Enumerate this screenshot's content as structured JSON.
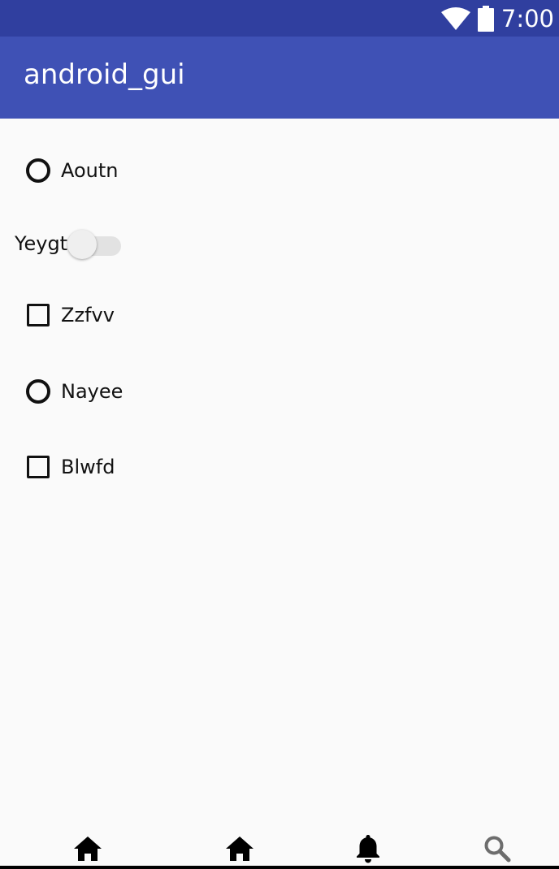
{
  "status_bar": {
    "time": "7:00",
    "icons": [
      "wifi-icon",
      "battery-icon"
    ],
    "color": "#303f9f"
  },
  "app_bar": {
    "title": "android_gui",
    "color": "#3f51b5"
  },
  "controls": {
    "radio_1": {
      "label": "Aoutn",
      "checked": false
    },
    "switch_1": {
      "label": "Yeygt",
      "on": false
    },
    "checkbox_1": {
      "label": "Zzfvv",
      "checked": false
    },
    "radio_2": {
      "label": "Nayee",
      "checked": false
    },
    "checkbox_2": {
      "label": "Blwfd",
      "checked": false
    }
  },
  "bottom_nav": {
    "items": [
      {
        "icon": "home-icon"
      },
      {
        "icon": "home-icon"
      },
      {
        "icon": "bell-icon"
      },
      {
        "icon": "search-icon"
      }
    ]
  }
}
